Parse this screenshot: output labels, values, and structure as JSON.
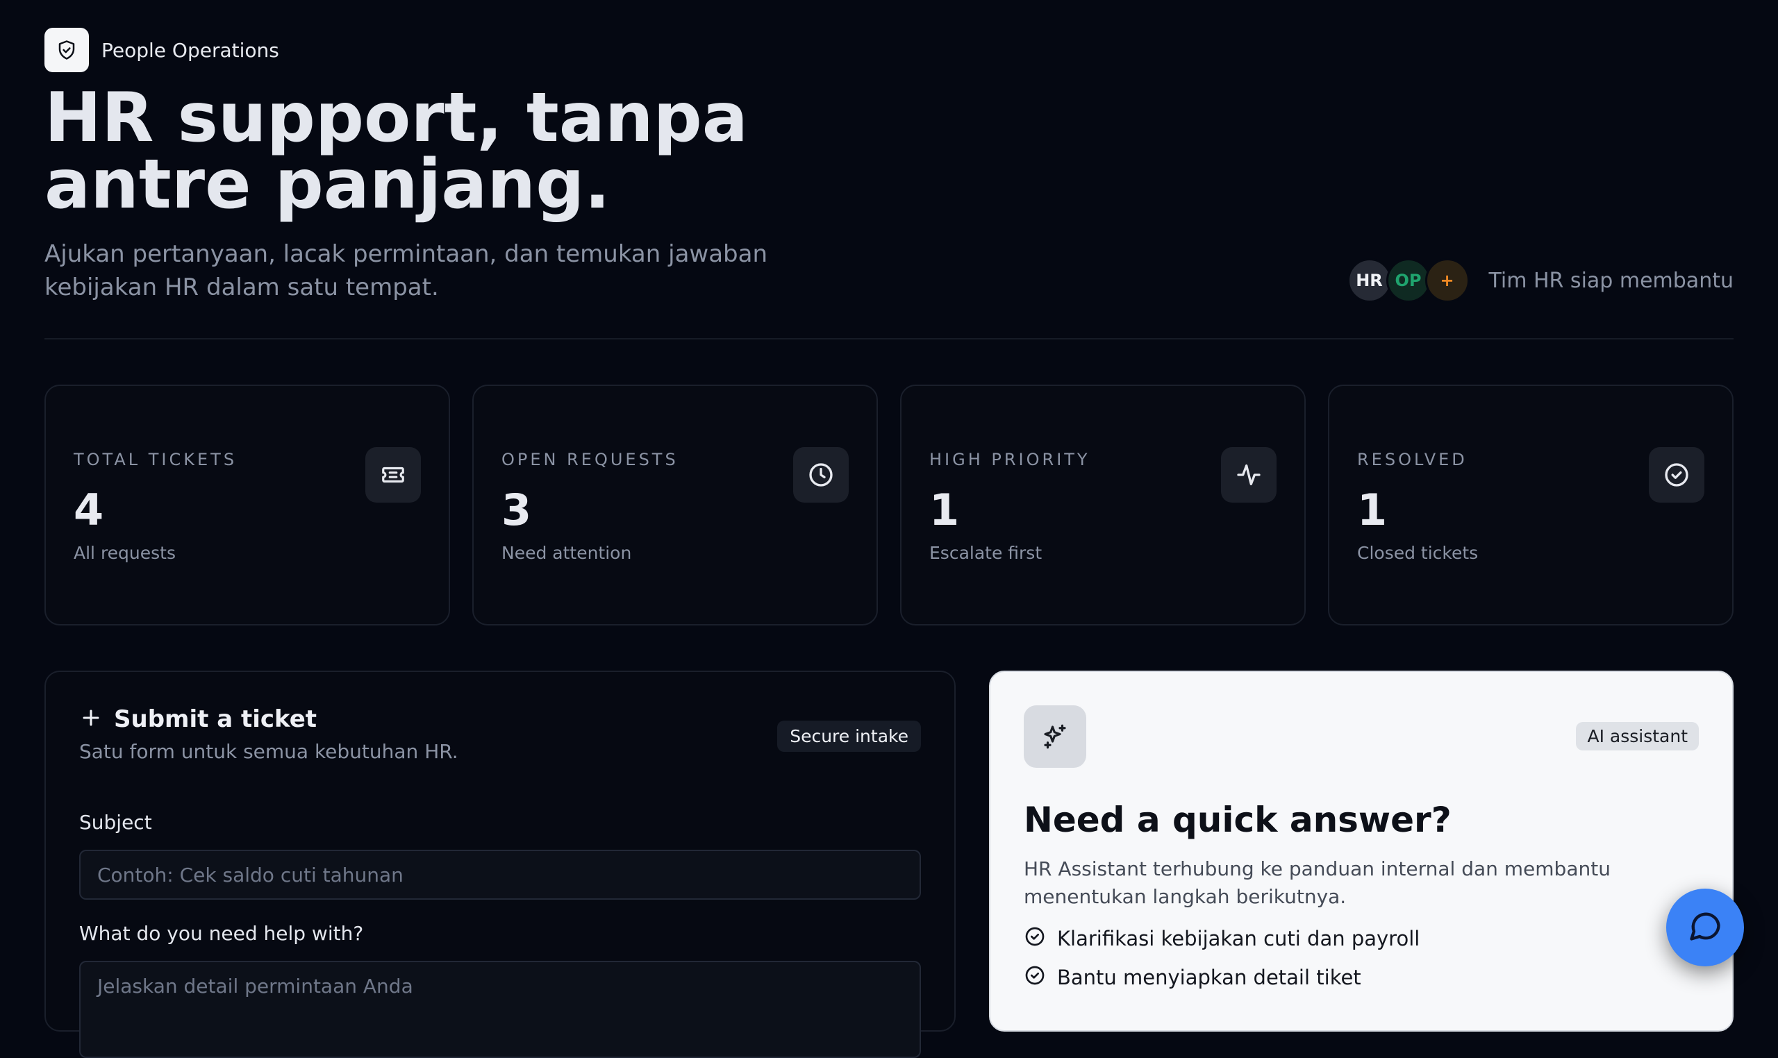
{
  "brand": {
    "name": "People Operations",
    "icon": "shield-check-icon"
  },
  "hero": {
    "title": "HR support, tanpa antre panjang.",
    "subtitle": "Ajukan pertanyaan, lacak permintaan, dan temukan jawaban kebijakan HR dalam satu tempat."
  },
  "team": {
    "avatars": [
      "HR",
      "OP",
      "+"
    ],
    "label": "Tim HR siap membantu"
  },
  "stats": [
    {
      "label": "TOTAL TICKETS",
      "value": "4",
      "note": "All requests",
      "icon": "ticket-icon"
    },
    {
      "label": "OPEN REQUESTS",
      "value": "3",
      "note": "Need attention",
      "icon": "clock-icon"
    },
    {
      "label": "HIGH PRIORITY",
      "value": "1",
      "note": "Escalate first",
      "icon": "activity-icon"
    },
    {
      "label": "RESOLVED",
      "value": "1",
      "note": "Closed tickets",
      "icon": "check-circle-icon"
    }
  ],
  "ticket": {
    "title": "Submit a ticket",
    "subtitle": "Satu form untuk semua kebutuhan HR.",
    "badge": "Secure intake",
    "subject_label": "Subject",
    "subject_placeholder": "Contoh: Cek saldo cuti tahunan",
    "details_label": "What do you need help with?",
    "details_placeholder": "Jelaskan detail permintaan Anda"
  },
  "assistant": {
    "badge": "AI assistant",
    "title": "Need a quick answer?",
    "description": "HR Assistant terhubung ke panduan internal dan membantu menentukan langkah berikutnya.",
    "items": [
      "Klarifikasi kebijakan cuti dan payroll",
      "Bantu menyiapkan detail tiket"
    ]
  },
  "colors": {
    "background": "#050812",
    "accent": "#3b82f6"
  }
}
